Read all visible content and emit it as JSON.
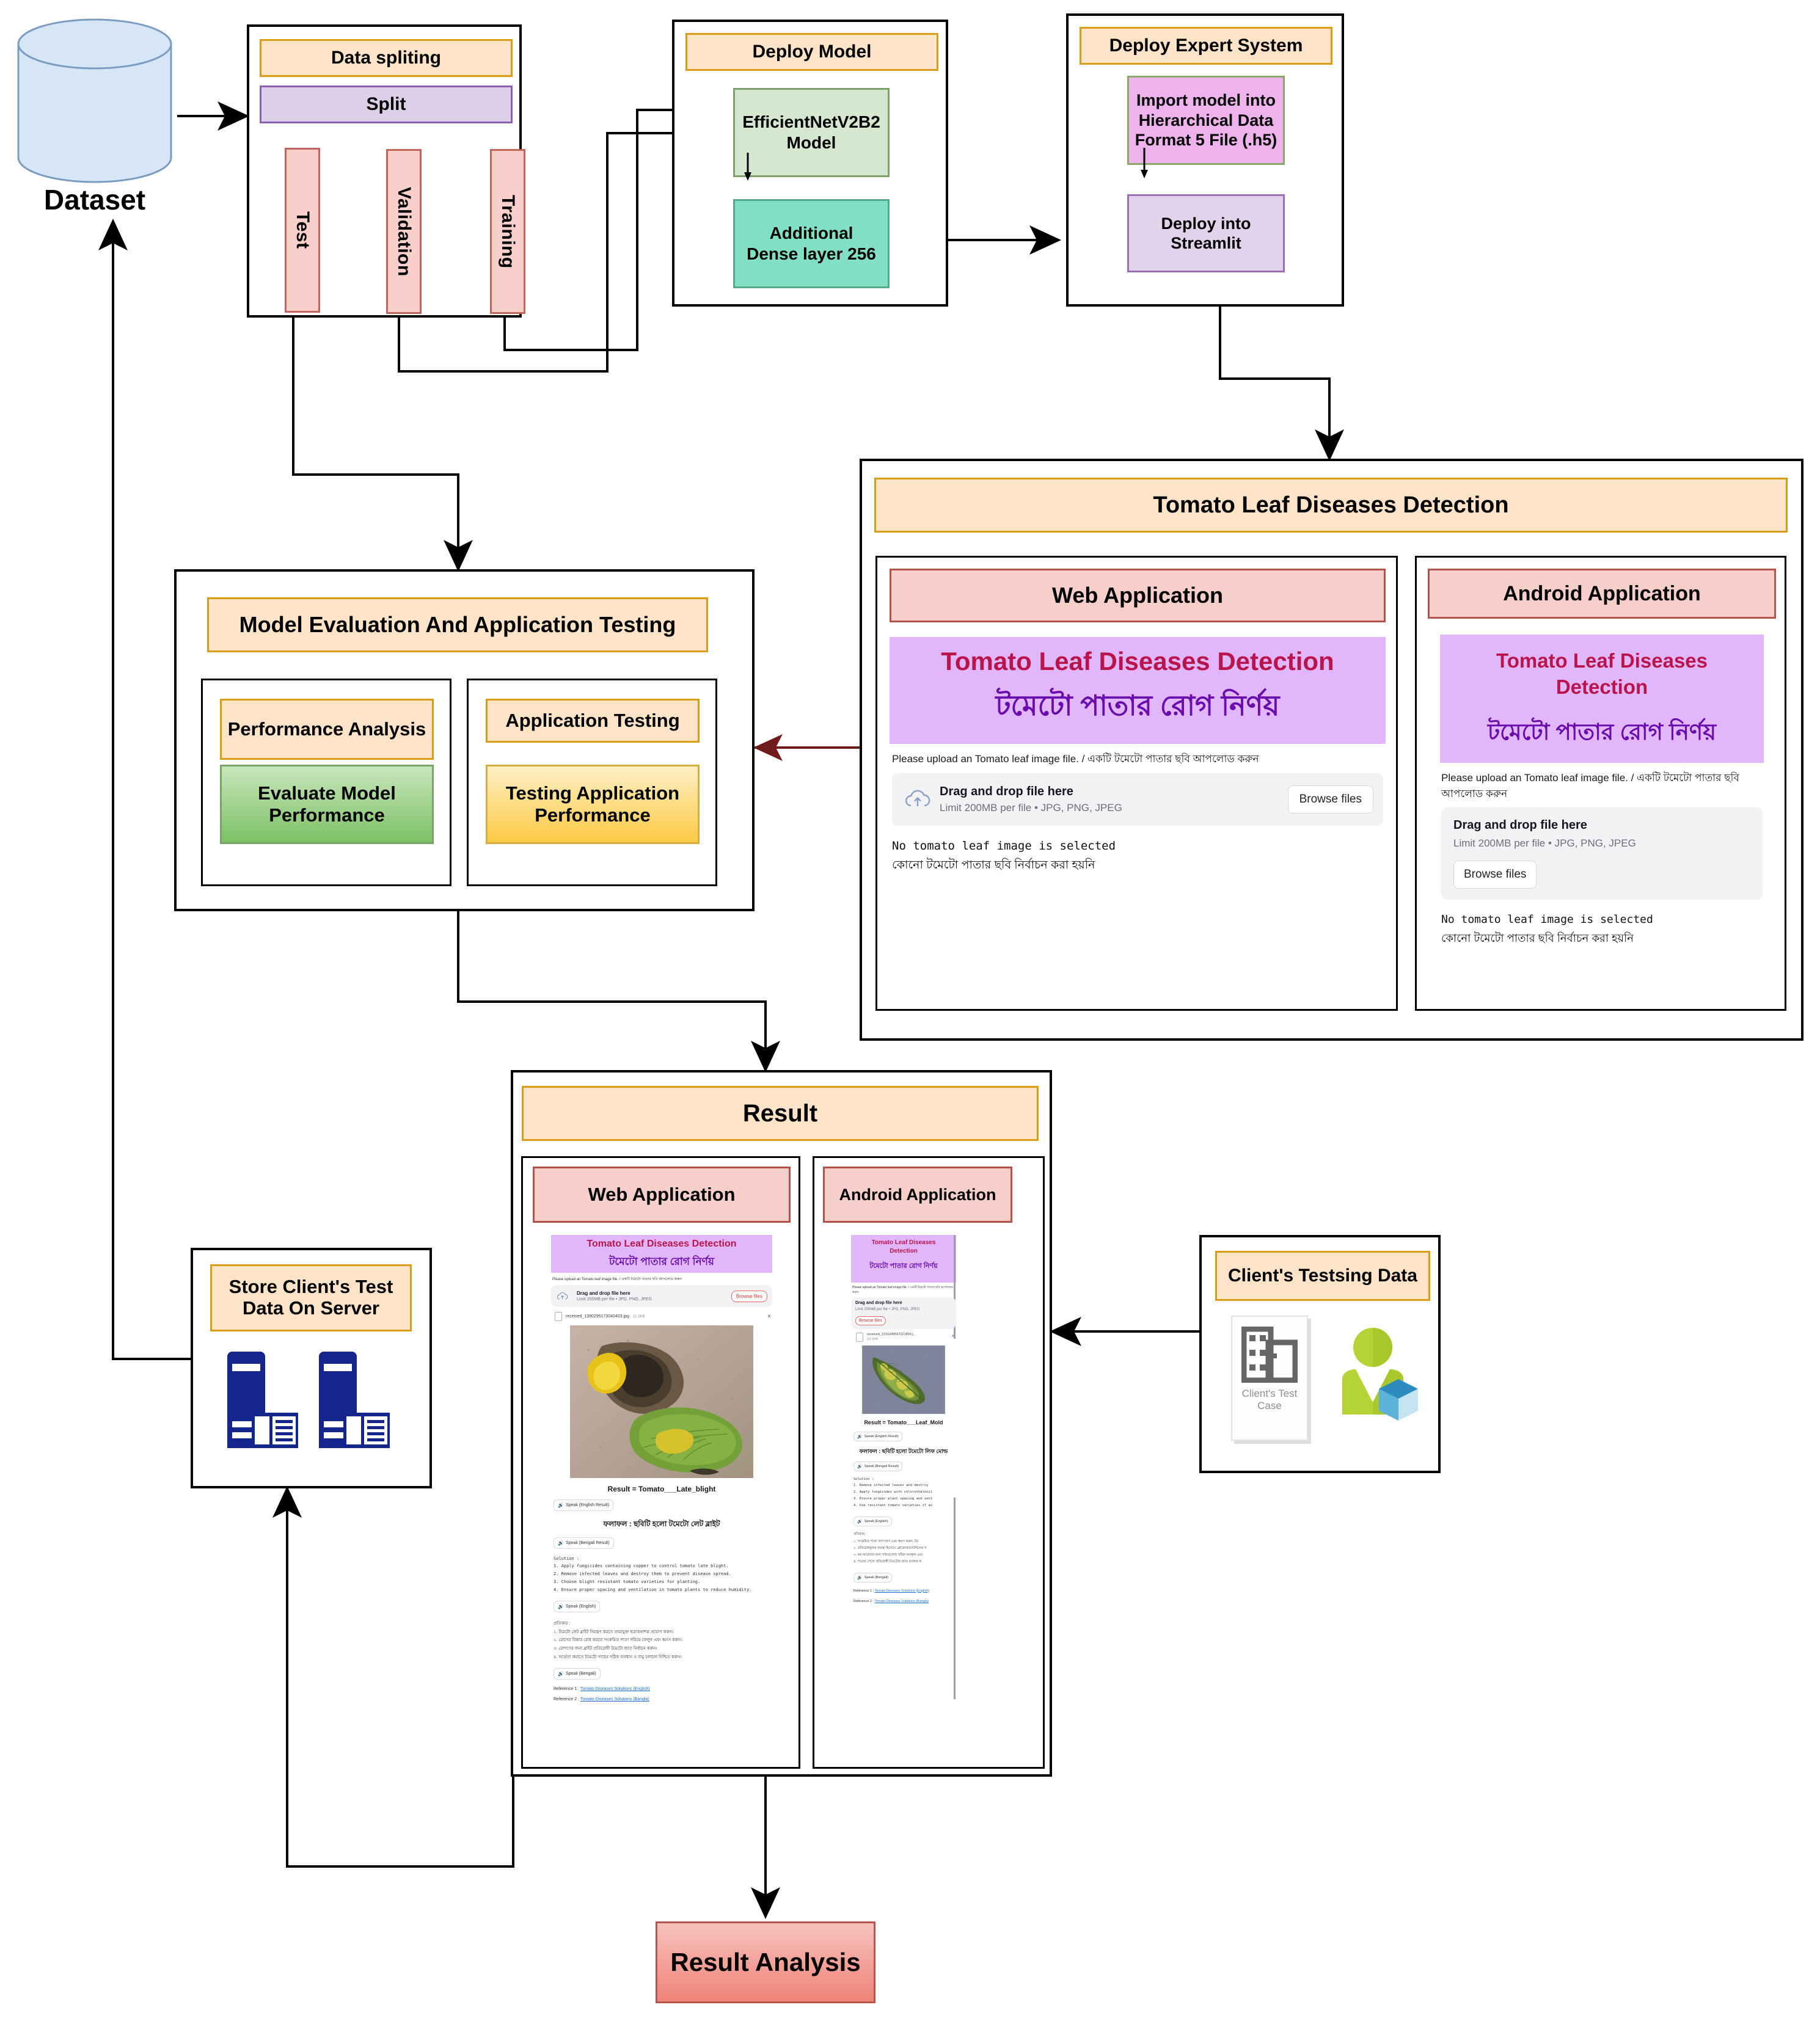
{
  "dataset": {
    "label": "Dataset",
    "icon": "database-cylinder-icon"
  },
  "data_splitting": {
    "title": "Data spliting",
    "split": "Split",
    "columns": [
      "Test",
      "Validation",
      "Training"
    ]
  },
  "deploy_model": {
    "title": "Deploy Model",
    "model": "EfficientNetV2B2 Model",
    "dense": "Additional Dense layer 256"
  },
  "deploy_expert_system": {
    "title": "Deploy Expert System",
    "import": "Import model into Hierarchical Data Format 5 File (.h5)",
    "streamlit": "Deploy into Streamlit"
  },
  "model_evaluation": {
    "title": "Model Evaluation And Application Testing",
    "left": {
      "heading": "Performance Analysis",
      "body": "Evaluate Model Performance"
    },
    "right": {
      "heading": "Application Testing",
      "body": "Testing Application Performance"
    }
  },
  "detection": {
    "title": "Tomato Leaf Diseases Detection",
    "web": {
      "label": "Web Application",
      "app_title_en": "Tomato Leaf Diseases Detection",
      "app_title_bn": "টমেটো পাতার রোগ নির্ণয়",
      "upload_note": "Please upload an Tomato leaf image file. / একটি টমেটো পাতার ছবি আপলোড করুন",
      "drop_title": "Drag and drop file here",
      "drop_limit": "Limit 200MB per file • JPG, PNG, JPEG",
      "browse": "Browse files",
      "status_en": "No tomato leaf image is selected",
      "status_bn": "কোনো টমেটো পাতার ছবি নির্বাচন করা হয়নি"
    },
    "android": {
      "label": "Android Application",
      "app_title_en": "Tomato Leaf Diseases Detection",
      "app_title_bn": "টমেটো পাতার রোগ নির্ণয়",
      "upload_note": "Please upload an Tomato leaf image file. / একটি টমেটো পাতার ছবি আপলোড করুন",
      "drop_title": "Drag and drop file here",
      "drop_limit": "Limit 200MB per file • JPG, PNG, JPEG",
      "browse": "Browse files",
      "status_en": "No tomato leaf image is selected",
      "status_bn": "কোনো টমেটো পাতার ছবি নির্বাচন করা হয়নি"
    }
  },
  "result": {
    "title": "Result",
    "web": {
      "label": "Web Application",
      "app_title_en": "Tomato Leaf Diseases Detection",
      "app_title_bn": "টমেটো পাতার রোগ নির্ণয়",
      "upload_note": "Please upload an Tomato leaf image file. / একটি টমেটো পাতার ছবি আপলোড করুন",
      "drop_title": "Drag and drop file here",
      "drop_limit": "Limit 200MB per file • JPG, PNG, JPEG",
      "browse": "Browse files",
      "file_name": "received_1390295173040403.jpg",
      "file_size": "21.3KB",
      "remove": "×",
      "result_line": "Result = Tomato___Late_blight",
      "speak_en_result": "Speak (English Result)",
      "result_bn": "ফলাফল : ছবিটি হলো টমেটো লেট ব্লাইট",
      "speak_bn_result": "Speak (Bengali Result)",
      "solution_heading": "Solution :",
      "solutions_en": [
        "1. Apply fungicides containing copper to control tomato late blight.",
        "2. Remove infected leaves and destroy them to prevent disease spread.",
        "3. Choose blight resistant tomato varieties for planting.",
        "4. Ensure proper spacing and ventilation in tomato plants to reduce humidity."
      ],
      "speak_en": "Speak (English)",
      "solution_heading_bn": "প্রতিকার :",
      "solutions_bn": [
        "১. টমেটো লেট ব্লাইট নিয়ন্ত্রণ করতে তামাযুক্ত ছত্রাকনাশক প্রয়োগ করুন।",
        "২. রোগের বিস্তার রোধ করতে সংক্রমিত পাতা সরিয়ে ফেলুন এবং ধ্বংস করুন।",
        "৩. রোপণের জন্য ব্লাইট প্রতিরোধী টমেটো জাত নির্বাচন করুন।",
        "৪. আর্দ্রতা কমাতে টমেটো গাছের সঠিক ব্যবধান ও বায়ু চলাচল নিশ্চিত করুন।"
      ],
      "speak_bn": "Speak (Bengali)",
      "ref1_label": "Reference 1 : ",
      "ref1_link": "Tomato Diseases Solutions (English)",
      "ref2_label": "Reference 2 : ",
      "ref2_link": "Tomato Diseases Solutions (Bangla)"
    },
    "android": {
      "label": "Android Application",
      "app_title_en": "Tomato Leaf Diseases Detection",
      "app_title_bn": "টমেটো পাতার রোগ নির্ণয়",
      "upload_note": "Please upload an Tomato leaf image file. / একটি টমেটো পাতার ছবি আপলোড করুন",
      "drop_title": "Drag and drop file here",
      "drop_limit": "Limit 200MB per file • JPG, PNG, JPEG",
      "browse": "Browse files",
      "file_name": "received_1231049567021800.j...",
      "file_size": "19.1KB",
      "remove": "×",
      "result_line": "Result = Tomato___Leaf_Mold",
      "speak_en_result": "Speak (English Result)",
      "result_bn": "ফলাফল : ছবিটি হলো টমেটো লিফ মোল্ড",
      "speak_bn_result": "Speak (Bengali Result)",
      "solution_heading": "Solution :",
      "solutions_en": [
        "1. Remove infected leaves and destroy",
        "2. Apply fungicides with chlorothalonil",
        "3. Ensure proper plant spacing and vent",
        "4. Use resistant tomato varieties if av"
      ],
      "speak_en": "Speak (English)",
      "solution_heading_bn": "প্রতিকার :",
      "solutions_bn": [
        "১. সংক্রমিত পাতা অপসারণ এবং ধ্বংস করুন; টম",
        "২. প্রতিরোধমূলক ব্যবস্থা হিসেবে ক্লোরোথ্যালোনিলের স",
        "৩. কম আর্দ্রতার জন্য গাছগুলোর সঠিক অবস্থান এবং",
        "৪. পাওয়া গেলে প্রতিরোধী টমেটোর জাত ব্যবহার ক"
      ],
      "speak_bn": "Speak (Bengali)",
      "ref1_label": "Reference 1 : ",
      "ref1_link": "Tomato Diseases Solutions (English)",
      "ref2_label": "Reference 2 : ",
      "ref2_link": "Tomato Diseases Solutions (Bangla)"
    }
  },
  "store_server": {
    "title": "Store Client's Test Data On Server",
    "icon": "server-tower-icon"
  },
  "client_data": {
    "title": "Client's Testsing Data",
    "card_label": "Client's Test Case",
    "card_icon": "building-grid-icon",
    "person_icon": "person-with-cube-icon"
  },
  "result_analysis": {
    "title": "Result Analysis"
  },
  "colors": {
    "orange_fill": "#fde4c8",
    "orange_border": "#d99c14",
    "pink_fill": "#f6cfcb",
    "pink_border": "#b5524b",
    "purple_fill": "#ddcfe8",
    "green_fill": "#d6e7d0",
    "teal_fill": "#81e0c4",
    "magenta_fill": "#eeb2ec",
    "lilac_fill": "#e3d2ec",
    "banner_purple": "#e2b6fb",
    "title_crimson": "#b9154c",
    "title_violet": "#6a0dad",
    "link_blue": "#1a6fd4",
    "server_blue": "#14268c",
    "person_green": "#b5d334",
    "cube_blue": "#2e8bc0"
  }
}
